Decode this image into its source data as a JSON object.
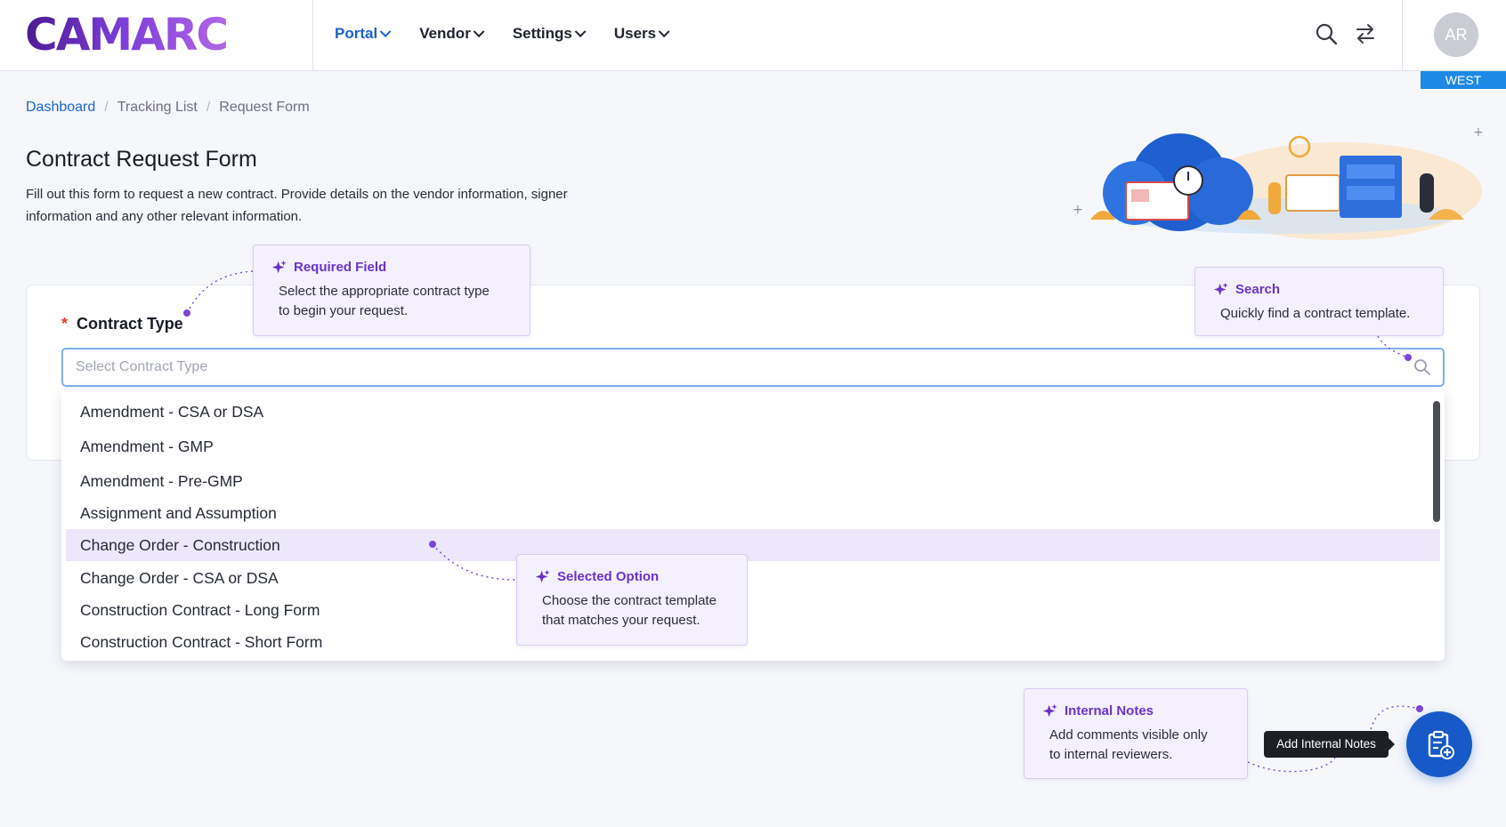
{
  "header": {
    "logo_text": "CAMARC",
    "nav": [
      {
        "label": "Portal",
        "active": true
      },
      {
        "label": "Vendor"
      },
      {
        "label": "Settings"
      },
      {
        "label": "Users"
      }
    ],
    "avatar_initials": "AR",
    "region_badge": "WEST",
    "icons": [
      "search-icon",
      "switch-arrows-icon"
    ]
  },
  "breadcrumb": {
    "items": [
      "Dashboard",
      "Tracking List",
      "Request Form"
    ],
    "separator": "/"
  },
  "page": {
    "title": "Contract Request Form",
    "description": "Fill out this form to request a new contract. Provide details on the vendor information, signer information and any other relevant information."
  },
  "form": {
    "required_marker": "*",
    "field_label": "Contract Type",
    "placeholder": "Select Contract Type",
    "value": "",
    "options": [
      "Amendment - CSA or DSA",
      "Amendment - GMP",
      "Amendment - Pre-GMP",
      "Assignment and Assumption",
      "Change Order - Construction",
      "Change Order - CSA or DSA",
      "Construction Contract - Long Form",
      "Construction Contract - Short Form"
    ],
    "highlighted_option": "Change Order - Construction"
  },
  "callouts": {
    "required": {
      "title": "Required Field",
      "body_lines": [
        "Select the appropriate contract type",
        "to begin your request."
      ]
    },
    "search": {
      "title": "Search",
      "body_lines": [
        "Quickly find a contract template."
      ]
    },
    "selected": {
      "title": "Selected Option",
      "body_lines": [
        "Choose the contract template",
        "that matches your request."
      ]
    },
    "notes": {
      "title": "Internal Notes",
      "body_lines": [
        "Add comments visible only",
        "to internal reviewers."
      ]
    }
  },
  "fab": {
    "tooltip": "Add Internal Notes",
    "icon": "clipboard-add-icon"
  },
  "colors": {
    "accent_blue": "#1b64c8",
    "accent_purple": "#6c33c9",
    "highlight_row": "#ece7fb",
    "region_badge": "#1e88e5",
    "fab": "#1659c7"
  }
}
